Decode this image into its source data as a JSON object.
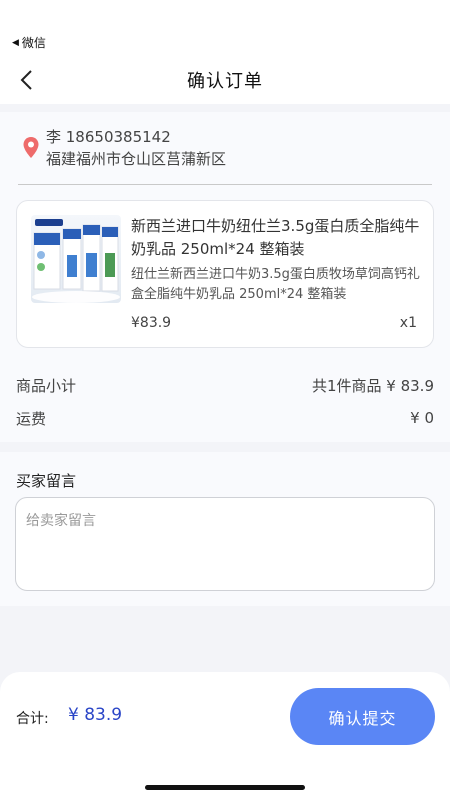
{
  "status_bar": {
    "back_label": "微信"
  },
  "nav": {
    "title": "确认订单"
  },
  "address": {
    "name_phone": "李 18650385142",
    "detail": "福建福州市仓山区莒蒲新区"
  },
  "product": {
    "name": "新西兰进口牛奶纽仕兰3.5g蛋白质全脂纯牛奶乳品 250ml*24 整箱装",
    "description": "纽仕兰新西兰进口牛奶3.5g蛋白质牧场草饲高钙礼盒全脂纯牛奶乳品 250ml*24 整箱装",
    "price": "¥83.9",
    "quantity": "x1"
  },
  "summary": {
    "subtotal_label": "商品小计",
    "subtotal_value": "共1件商品 ¥ 83.9",
    "shipping_label": "运费",
    "shipping_value": "¥ 0"
  },
  "message": {
    "label": "买家留言",
    "placeholder": "给卖家留言"
  },
  "footer": {
    "total_label": "合计:",
    "total_value": "¥ 83.9",
    "submit_label": "确认提交"
  },
  "colors": {
    "accent": "#5a86f5",
    "price_blue": "#2a45c7",
    "pin_red": "#ee6b6b"
  }
}
